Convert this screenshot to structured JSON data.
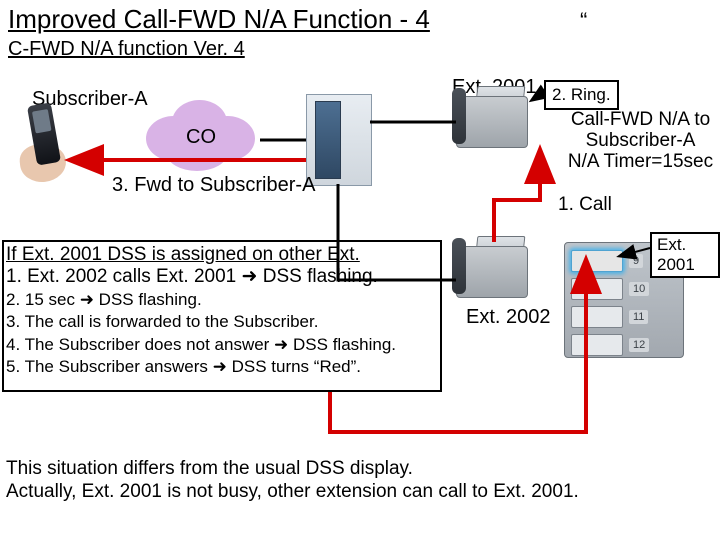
{
  "title": "Improved Call-FWD N/A Function - 4",
  "stray": "“",
  "subtitle": "C-FWD N/A function Ver. 4",
  "subscriber_a": "Subscriber-A",
  "ext_a": "Ext. 2001",
  "ring_box": "2. Ring.",
  "cfwd": {
    "l1": "Call-FWD N/A to",
    "l2": "Subscriber-A",
    "l3": "N/A Timer=15sec"
  },
  "call_label": "1. Call",
  "co_label": "CO",
  "fwd_label": "3. Fwd to Subscriber-A",
  "ext_b": "Ext. 2002",
  "ext_bubble": "Ext. 2001",
  "dss_keys": [
    "9",
    "10",
    "11",
    "12"
  ],
  "para1": {
    "hdr": "If Ext. 2001 DSS is assigned on other Ext.",
    "l1": "1. Ext. 2002 calls Ext. 2001 ➜ DSS flashing.",
    "l2": "2. 15 sec ➜ DSS flashing.",
    "l3": "3. The call is forwarded to the Subscriber.",
    "l4": "4. The Subscriber does not answer ➜ DSS flashing.",
    "l5": "5. The Subscriber answers ➜ DSS turns “Red”."
  },
  "para2": {
    "l1": "This situation differs from the usual DSS display.",
    "l2": "Actually, Ext. 2001 is not busy, other extension can call to Ext. 2001."
  }
}
